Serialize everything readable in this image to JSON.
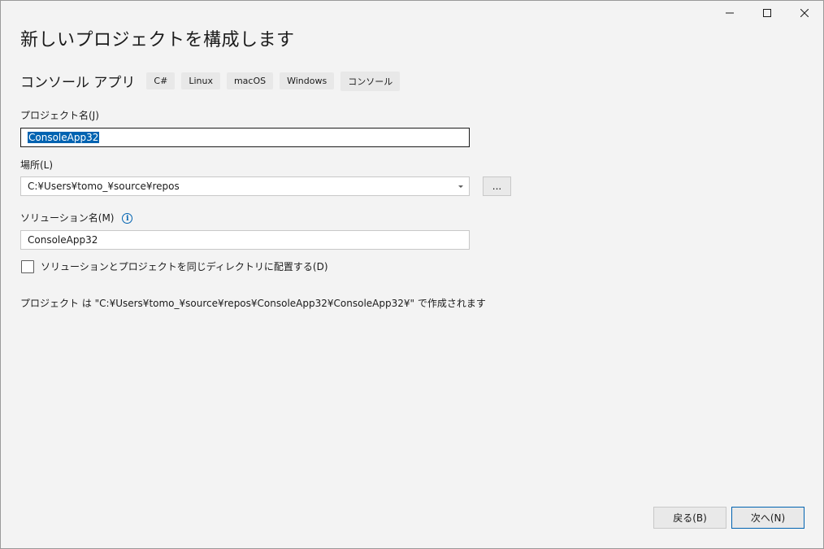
{
  "window": {
    "caption": {
      "minimize_icon": "minimize-icon",
      "maximize_icon": "maximize-icon",
      "close_icon": "close-icon"
    }
  },
  "title": "新しいプロジェクトを構成します",
  "template": {
    "name": "コンソール アプリ",
    "tags": [
      "C#",
      "Linux",
      "macOS",
      "Windows",
      "コンソール"
    ]
  },
  "project_name": {
    "label": "プロジェクト名(J)",
    "value": "ConsoleApp32"
  },
  "location": {
    "label": "場所(L)",
    "value": "C:¥Users¥tomo_¥source¥repos",
    "browse_label": "..."
  },
  "solution_name": {
    "label": "ソリューション名(M)",
    "value": "ConsoleApp32",
    "info_icon": "info-icon"
  },
  "same_directory": {
    "label": "ソリューションとプロジェクトを同じディレクトリに配置する(D)",
    "checked": false
  },
  "path_info": "プロジェクト は \"C:¥Users¥tomo_¥source¥repos¥ConsoleApp32¥ConsoleApp32¥\" で作成されます",
  "footer": {
    "back_label": "戻る(B)",
    "next_label": "次へ(N)"
  },
  "colors": {
    "accent": "#0063b1",
    "background": "#f3f3f3",
    "selection": "#0063b1"
  }
}
